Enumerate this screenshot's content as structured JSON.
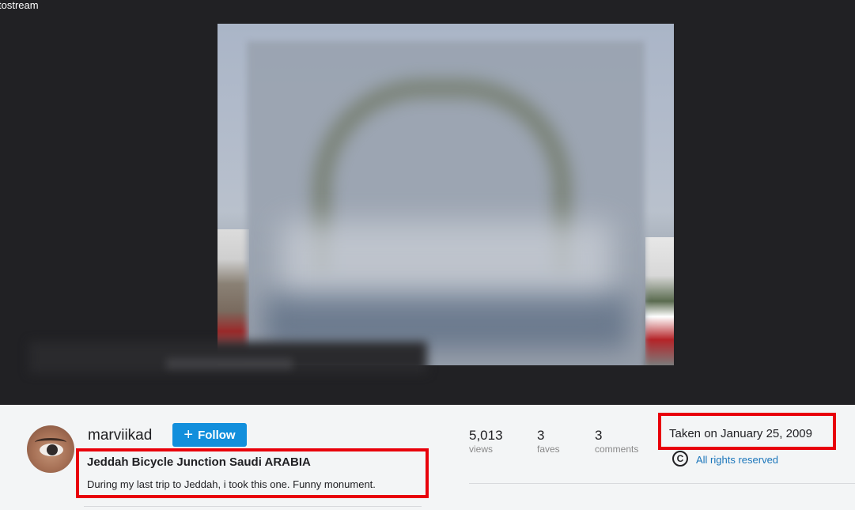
{
  "viewer": {
    "back_text": "tostream"
  },
  "owner": {
    "name": "marviikad",
    "follow_label": "Follow",
    "follow_icon": "plus-icon"
  },
  "photo": {
    "title": "Jeddah Bicycle Junction Saudi ARABIA",
    "description": "During my last trip to Jeddah, i took this one. Funny monument."
  },
  "stats": [
    {
      "value": "5,013",
      "label": "views"
    },
    {
      "value": "3",
      "label": "faves"
    },
    {
      "value": "3",
      "label": "comments"
    }
  ],
  "meta": {
    "taken": "Taken on January 25, 2009",
    "license": "All rights reserved",
    "license_icon_glyph": "C"
  },
  "colors": {
    "follow_bg": "#128fdc",
    "highlight": "#e8000b",
    "link": "#1b76bb"
  }
}
